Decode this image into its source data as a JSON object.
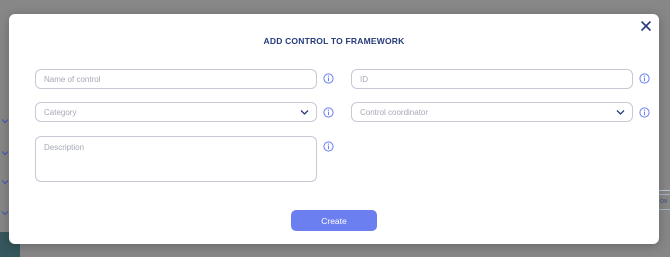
{
  "modal": {
    "title": "ADD CONTROL TO FRAMEWORK",
    "fields": {
      "name": {
        "placeholder": "Name of control",
        "value": ""
      },
      "id": {
        "placeholder": "ID",
        "value": ""
      },
      "category": {
        "placeholder": "Category"
      },
      "coordinator": {
        "placeholder": "Control coordinator"
      },
      "description": {
        "placeholder": "Description",
        "value": ""
      }
    },
    "create_label": "Create"
  },
  "background": {
    "edge_text": "ov"
  },
  "icons": {
    "close": "close-icon",
    "info": "info-icon",
    "dropdown": "chevron-down-icon"
  },
  "colors": {
    "accent": "#6c7ff1",
    "title": "#253b7a",
    "overlay": "#878787"
  }
}
